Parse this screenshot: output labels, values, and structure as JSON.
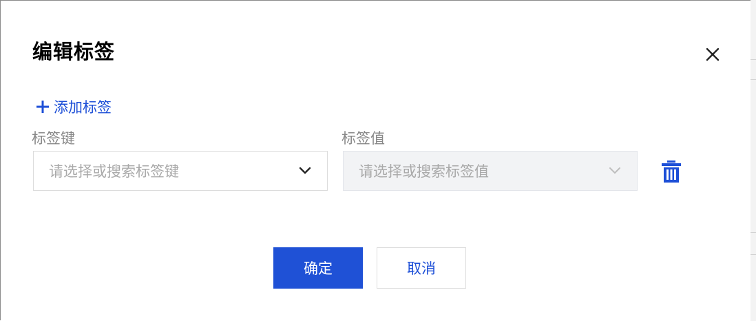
{
  "dialog": {
    "title": "编辑标签",
    "close_icon": "close-icon"
  },
  "add_tag": {
    "label": "添加标签",
    "icon": "plus-icon"
  },
  "tag_row": {
    "key_label": "标签键",
    "key_placeholder": "请选择或搜索标签键",
    "value_label": "标签值",
    "value_placeholder": "请选择或搜索标签值",
    "value_disabled": true,
    "delete_icon": "trash-icon"
  },
  "footer": {
    "confirm_label": "确定",
    "cancel_label": "取消"
  },
  "colors": {
    "accent": "#1f51d6",
    "link": "#1d4fd7",
    "label_gray": "#888888",
    "placeholder_gray": "#a9a9a9",
    "disabled_bg": "#f2f3f5"
  }
}
